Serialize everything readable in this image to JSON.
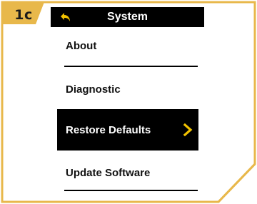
{
  "step_badge": "1c",
  "colors": {
    "accent": "#e8b84b",
    "header_bg": "#000000",
    "selected_bg": "#000000",
    "chevron": "#f2c200"
  },
  "header": {
    "title": "System",
    "back_icon": "back-arrow-icon"
  },
  "menu": {
    "items": [
      {
        "label": "About",
        "selected": false
      },
      {
        "label": "Diagnostic",
        "selected": false
      },
      {
        "label": "Restore Defaults",
        "selected": true,
        "icon": "chevron-right-icon"
      },
      {
        "label": "Update Software",
        "selected": false
      }
    ]
  }
}
